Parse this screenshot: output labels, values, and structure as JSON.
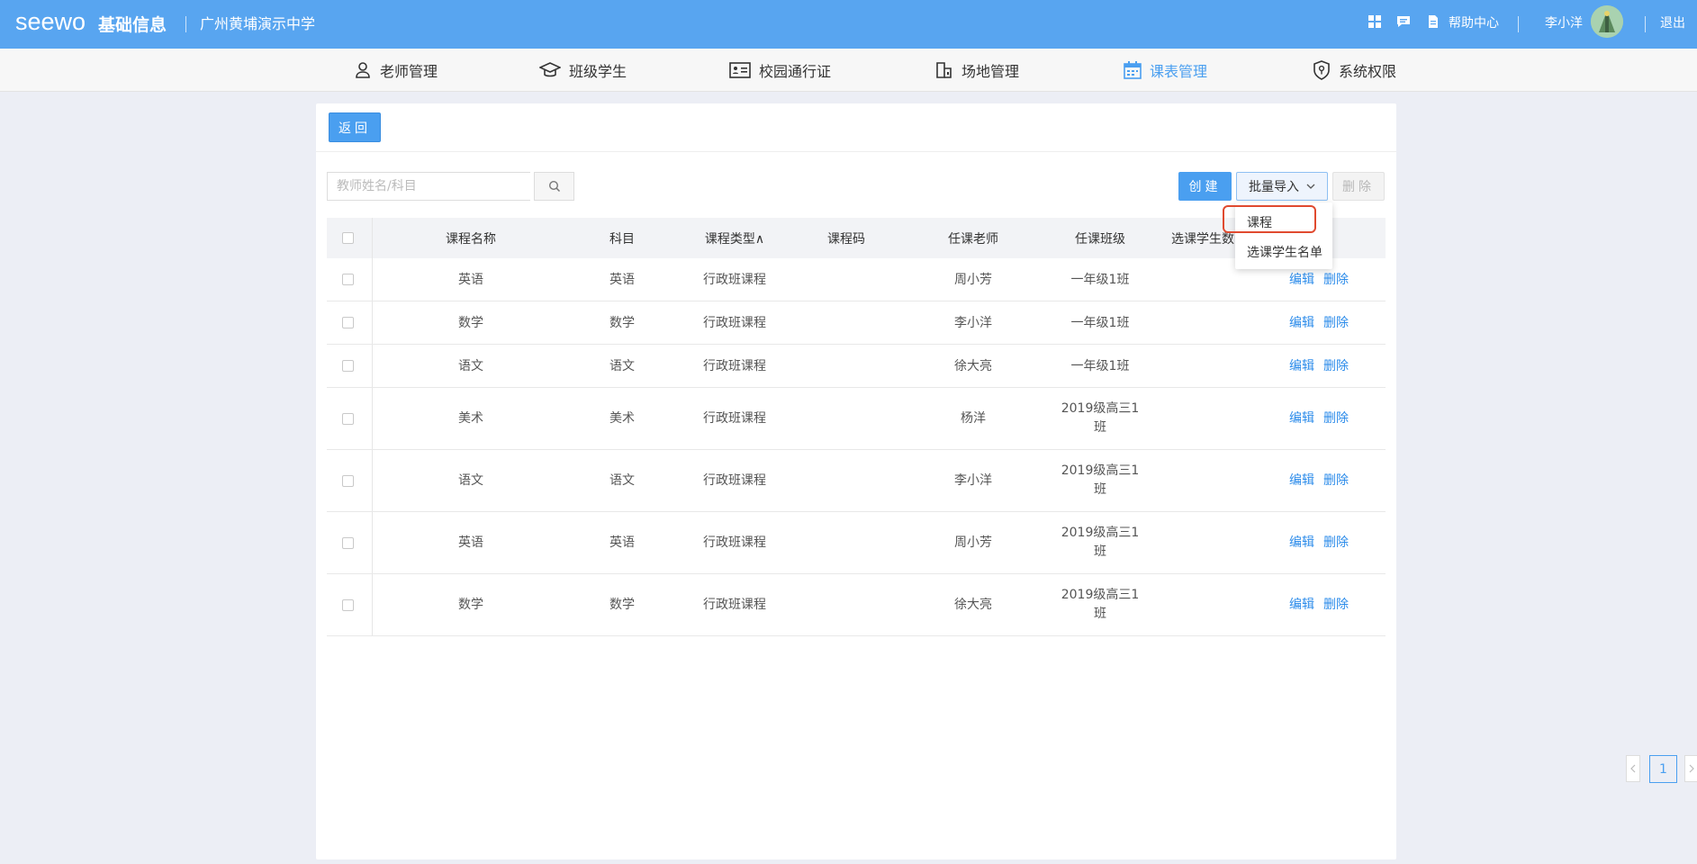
{
  "header": {
    "logo_text": "seewo",
    "product_name": "基础信息",
    "school_name": "广州黄埔演示中学",
    "help_label": "帮助中心",
    "user_name": "李小洋",
    "logout_label": "退出"
  },
  "nav": {
    "items": [
      {
        "label": "老师管理",
        "icon": "user-icon"
      },
      {
        "label": "班级学生",
        "icon": "graduation-cap-icon"
      },
      {
        "label": "校园通行证",
        "icon": "id-card-icon"
      },
      {
        "label": "场地管理",
        "icon": "building-icon"
      },
      {
        "label": "课表管理",
        "icon": "calendar-icon",
        "active": true
      },
      {
        "label": "系统权限",
        "icon": "shield-icon"
      }
    ]
  },
  "toolbar": {
    "back_label": "返回",
    "search_placeholder": "教师姓名/科目",
    "create_label": "创建",
    "import_label": "批量导入",
    "delete_label": "删除"
  },
  "import_menu": {
    "items": [
      "课程",
      "选课学生名单"
    ]
  },
  "table": {
    "headers": [
      "课程名称",
      "科目",
      "课程类型∧",
      "课程码",
      "任课老师",
      "任课班级",
      "选课学生数"
    ],
    "action_edit": "编辑",
    "action_delete": "删除",
    "rows": [
      {
        "name": "英语",
        "subject": "英语",
        "type": "行政班课程",
        "code": "",
        "teacher": "周小芳",
        "class": "一年级1班",
        "count": ""
      },
      {
        "name": "数学",
        "subject": "数学",
        "type": "行政班课程",
        "code": "",
        "teacher": "李小洋",
        "class": "一年级1班",
        "count": ""
      },
      {
        "name": "语文",
        "subject": "语文",
        "type": "行政班课程",
        "code": "",
        "teacher": "徐大亮",
        "class": "一年级1班",
        "count": ""
      },
      {
        "name": "美术",
        "subject": "美术",
        "type": "行政班课程",
        "code": "",
        "teacher": "杨洋",
        "class": "2019级高三1班",
        "count": ""
      },
      {
        "name": "语文",
        "subject": "语文",
        "type": "行政班课程",
        "code": "",
        "teacher": "李小洋",
        "class": "2019级高三1班",
        "count": ""
      },
      {
        "name": "英语",
        "subject": "英语",
        "type": "行政班课程",
        "code": "",
        "teacher": "周小芳",
        "class": "2019级高三1班",
        "count": ""
      },
      {
        "name": "数学",
        "subject": "数学",
        "type": "行政班课程",
        "code": "",
        "teacher": "徐大亮",
        "class": "2019级高三1班",
        "count": ""
      }
    ]
  },
  "pagination": {
    "current_page": "1"
  },
  "colors": {
    "primary": "#4a9ff0",
    "header_bg": "#58a5f0",
    "highlight": "#e04a2f"
  }
}
